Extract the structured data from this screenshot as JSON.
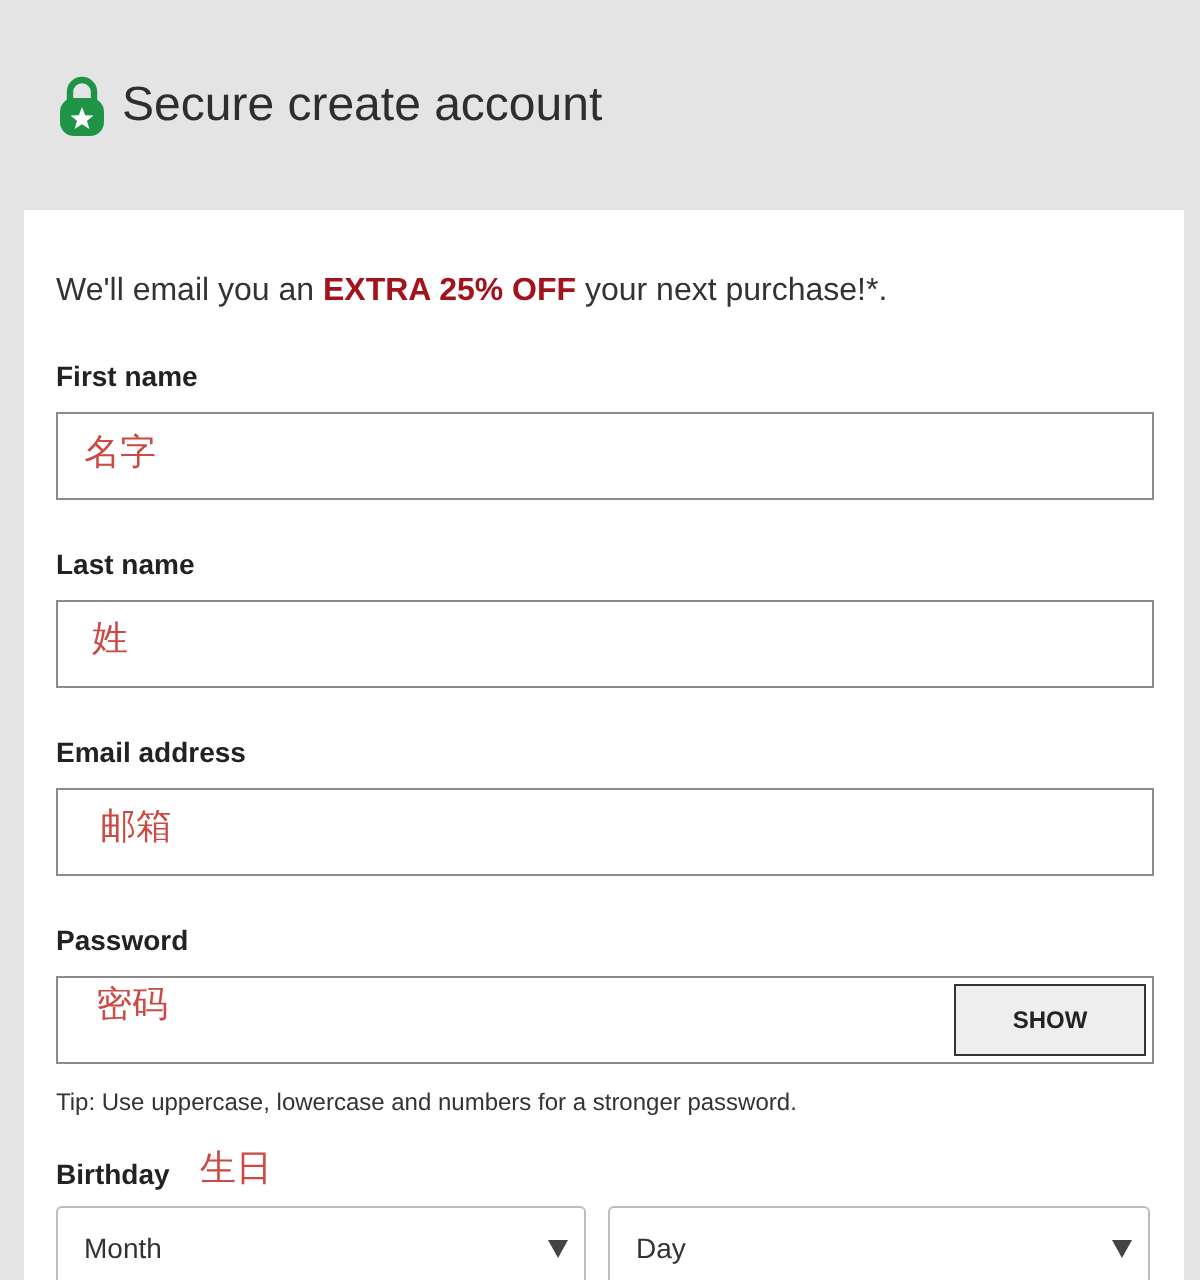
{
  "header": {
    "title": "Secure create account"
  },
  "intro": "We'll email you an **EXTRA 25% OFF** your next purchase!*.",
  "fields": [
    {
      "kind": "text",
      "label": "First name",
      "note": "名字"
    },
    {
      "kind": "text",
      "label": "Last name",
      "note": "姓"
    },
    {
      "kind": "text",
      "label": "Email address",
      "note": "邮箱"
    },
    {
      "kind": "password",
      "label": "Password",
      "note": "密码",
      "button": "SHOW",
      "tip": "Tip: Use uppercase, lowercase and numbers for a stronger password."
    }
  ],
  "birthday": {
    "label": "Birthday",
    "note": "生日",
    "selects": [
      {
        "value": "Month"
      },
      {
        "value": "Day"
      }
    ]
  }
}
